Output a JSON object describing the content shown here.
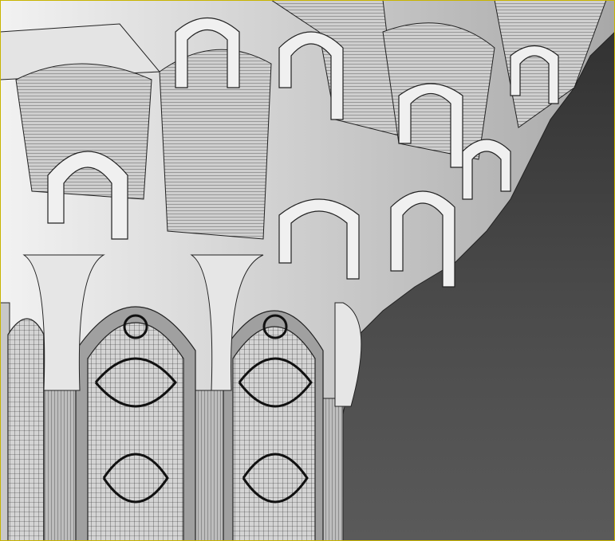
{
  "viewport": {
    "active_border_color": "#c8b400",
    "background_color": "#3c3c3c",
    "model_color": "#d8d8d8",
    "wire_color": "#222222"
  }
}
